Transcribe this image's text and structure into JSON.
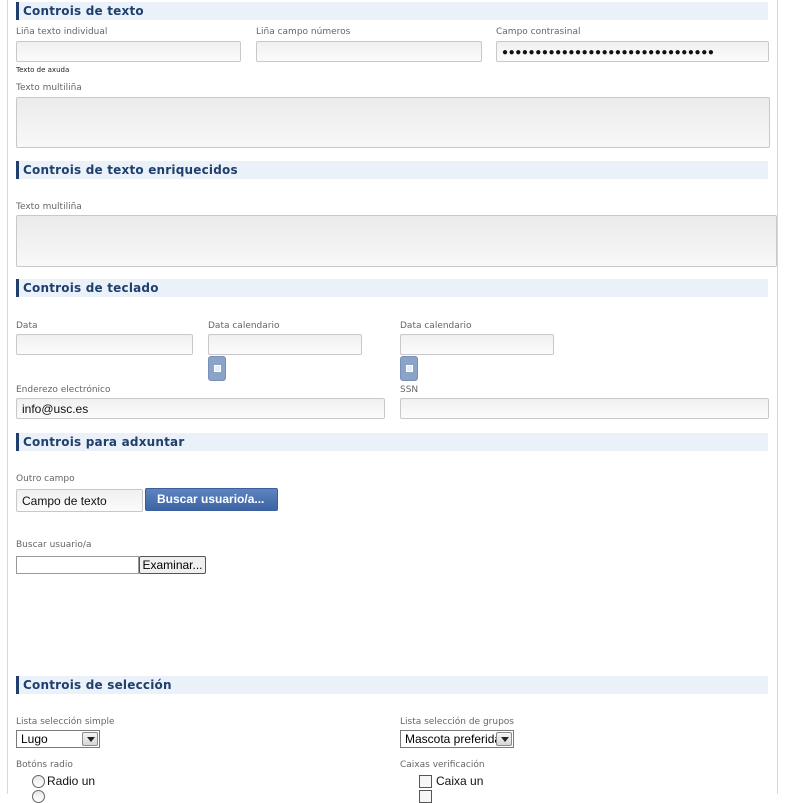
{
  "sections": {
    "text_controls": {
      "title": "Controis de texto",
      "single_line_label": "Liña texto individual",
      "numbers_label": "Liña campo números",
      "password_label": "Campo contrasinal",
      "password_value": "●●●●●●●●●●●●●●●●●●●●●●●●●●●●●●●●",
      "help_text": "Texto de axuda",
      "multiline_label": "Texto multiliña"
    },
    "rich_text_controls": {
      "title": "Controis de texto enriquecidos",
      "multiline_label": "Texto multiliña"
    },
    "keyboard_controls": {
      "title": "Controis de teclado",
      "date_label": "Data",
      "calendar_date_label_1": "Data calendario",
      "calendar_date_label_2": "Data calendario",
      "email_label": "Enderezo electrónico",
      "email_value": "info@usc.es",
      "ssn_label": "SSN"
    },
    "attach_controls": {
      "title": "Controis para adxuntar",
      "other_field_label": "Outro campo",
      "other_field_value": "Campo de texto",
      "search_user_button": "Buscar usuario/a...",
      "search_user_label": "Buscar usuario/a",
      "browse_button": "Examinar..."
    },
    "selection_controls": {
      "title": "Controis de selección",
      "simple_list_label": "Lista selección simple",
      "simple_list_value": "Lugo",
      "group_list_label": "Lista selección de grupos",
      "group_list_value": "Mascota preferida",
      "radio_label": "Botóns radio",
      "radio_option_1": "Radio un",
      "checkbox_label": "Caixas verificación",
      "checkbox_option_1": "Caixa un"
    }
  }
}
